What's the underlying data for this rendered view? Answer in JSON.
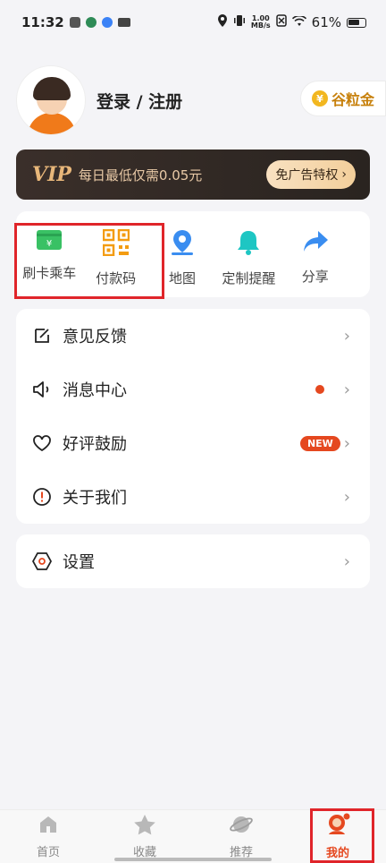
{
  "status_bar": {
    "time": "11:32",
    "net_speed_value": "1.00",
    "net_speed_unit": "MB/s",
    "battery": "61%"
  },
  "profile": {
    "login_label": "登录 / 注册",
    "coin_label": "谷粒金"
  },
  "vip": {
    "logo": "VIP",
    "text": "每日最低仅需0.05元",
    "button_label": "免广告特权"
  },
  "quick_actions": [
    {
      "label": "刷卡乘车",
      "icon": "card-icon"
    },
    {
      "label": "付款码",
      "icon": "qrcode-icon"
    },
    {
      "label": "地图",
      "icon": "map-pin-icon"
    },
    {
      "label": "定制提醒",
      "icon": "bell-icon"
    },
    {
      "label": "分享",
      "icon": "share-arrow-icon"
    }
  ],
  "menu": {
    "feedback": "意见反馈",
    "messages": "消息中心",
    "rating": "好评鼓励",
    "rating_badge": "NEW",
    "about": "关于我们",
    "settings": "设置"
  },
  "bottom_nav": [
    {
      "label": "首页",
      "icon": "home-icon"
    },
    {
      "label": "收藏",
      "icon": "star-icon"
    },
    {
      "label": "推荐",
      "icon": "planet-icon"
    },
    {
      "label": "我的",
      "icon": "profile-icon",
      "active": true
    }
  ],
  "colors": {
    "accent": "#e5481f",
    "highlight_border": "#e0252a",
    "vip_gold": "#e8b77a"
  }
}
